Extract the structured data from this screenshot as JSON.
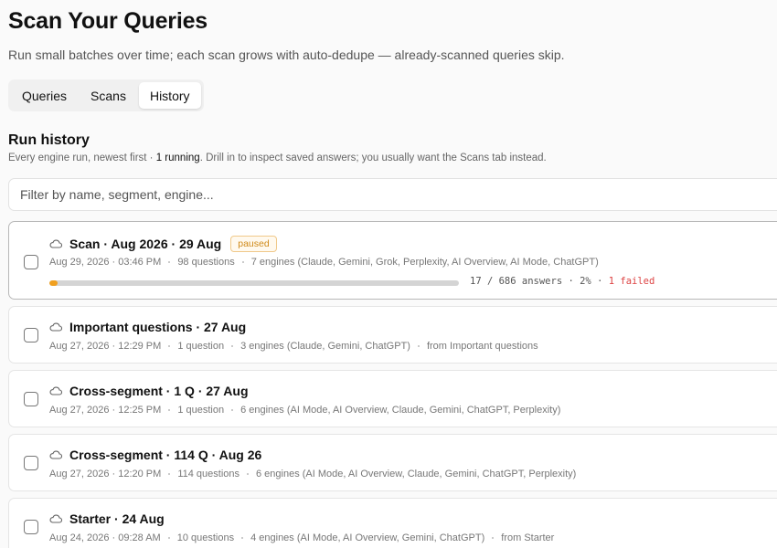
{
  "header": {
    "title": "Scan Your Queries",
    "subtitle": "Run small batches over time; each scan grows with auto-dedupe — already-scanned queries skip."
  },
  "tabs": [
    {
      "label": "Queries",
      "active": false
    },
    {
      "label": "Scans",
      "active": false
    },
    {
      "label": "History",
      "active": true
    }
  ],
  "history": {
    "title": "Run history",
    "desc_prefix": "Every engine run, newest first · ",
    "running": "1 running",
    "desc_suffix": ". Drill in to inspect saved answers; you usually want the Scans tab instead.",
    "filter_placeholder": "Filter by name, segment, engine..."
  },
  "runs": [
    {
      "title": "Scan · Aug 2026 · 29 Aug",
      "badge": "paused",
      "date": "Aug 29, 2026 · 03:46 PM",
      "questions": "98 questions",
      "engines": "7 engines (Claude, Gemini, Grok, Perplexity, AI Overview, AI Mode, ChatGPT)",
      "progress": {
        "fraction": 0.02,
        "counts": "17 / 686 answers · 2%",
        "sep": " · ",
        "failed": "1 failed"
      }
    },
    {
      "title": "Important questions · 27 Aug",
      "date": "Aug 27, 2026 · 12:29 PM",
      "questions": "1 question",
      "engines": "3 engines (Claude, Gemini, ChatGPT)",
      "source": "from Important questions"
    },
    {
      "title": "Cross-segment · 1 Q · 27 Aug",
      "date": "Aug 27, 2026 · 12:25 PM",
      "questions": "1 question",
      "engines": "6 engines (AI Mode, AI Overview, Claude, Gemini, ChatGPT, Perplexity)"
    },
    {
      "title": "Cross-segment · 114 Q · Aug 26",
      "date": "Aug 27, 2026 · 12:20 PM",
      "questions": "114 questions",
      "engines": "6 engines (AI Mode, AI Overview, Claude, Gemini, ChatGPT, Perplexity)"
    },
    {
      "title": "Starter · 24 Aug",
      "date": "Aug 24, 2026 · 09:28 AM",
      "questions": "10 questions",
      "engines": "4 engines (AI Mode, AI Overview, Gemini, ChatGPT)",
      "source": "from Starter"
    }
  ]
}
